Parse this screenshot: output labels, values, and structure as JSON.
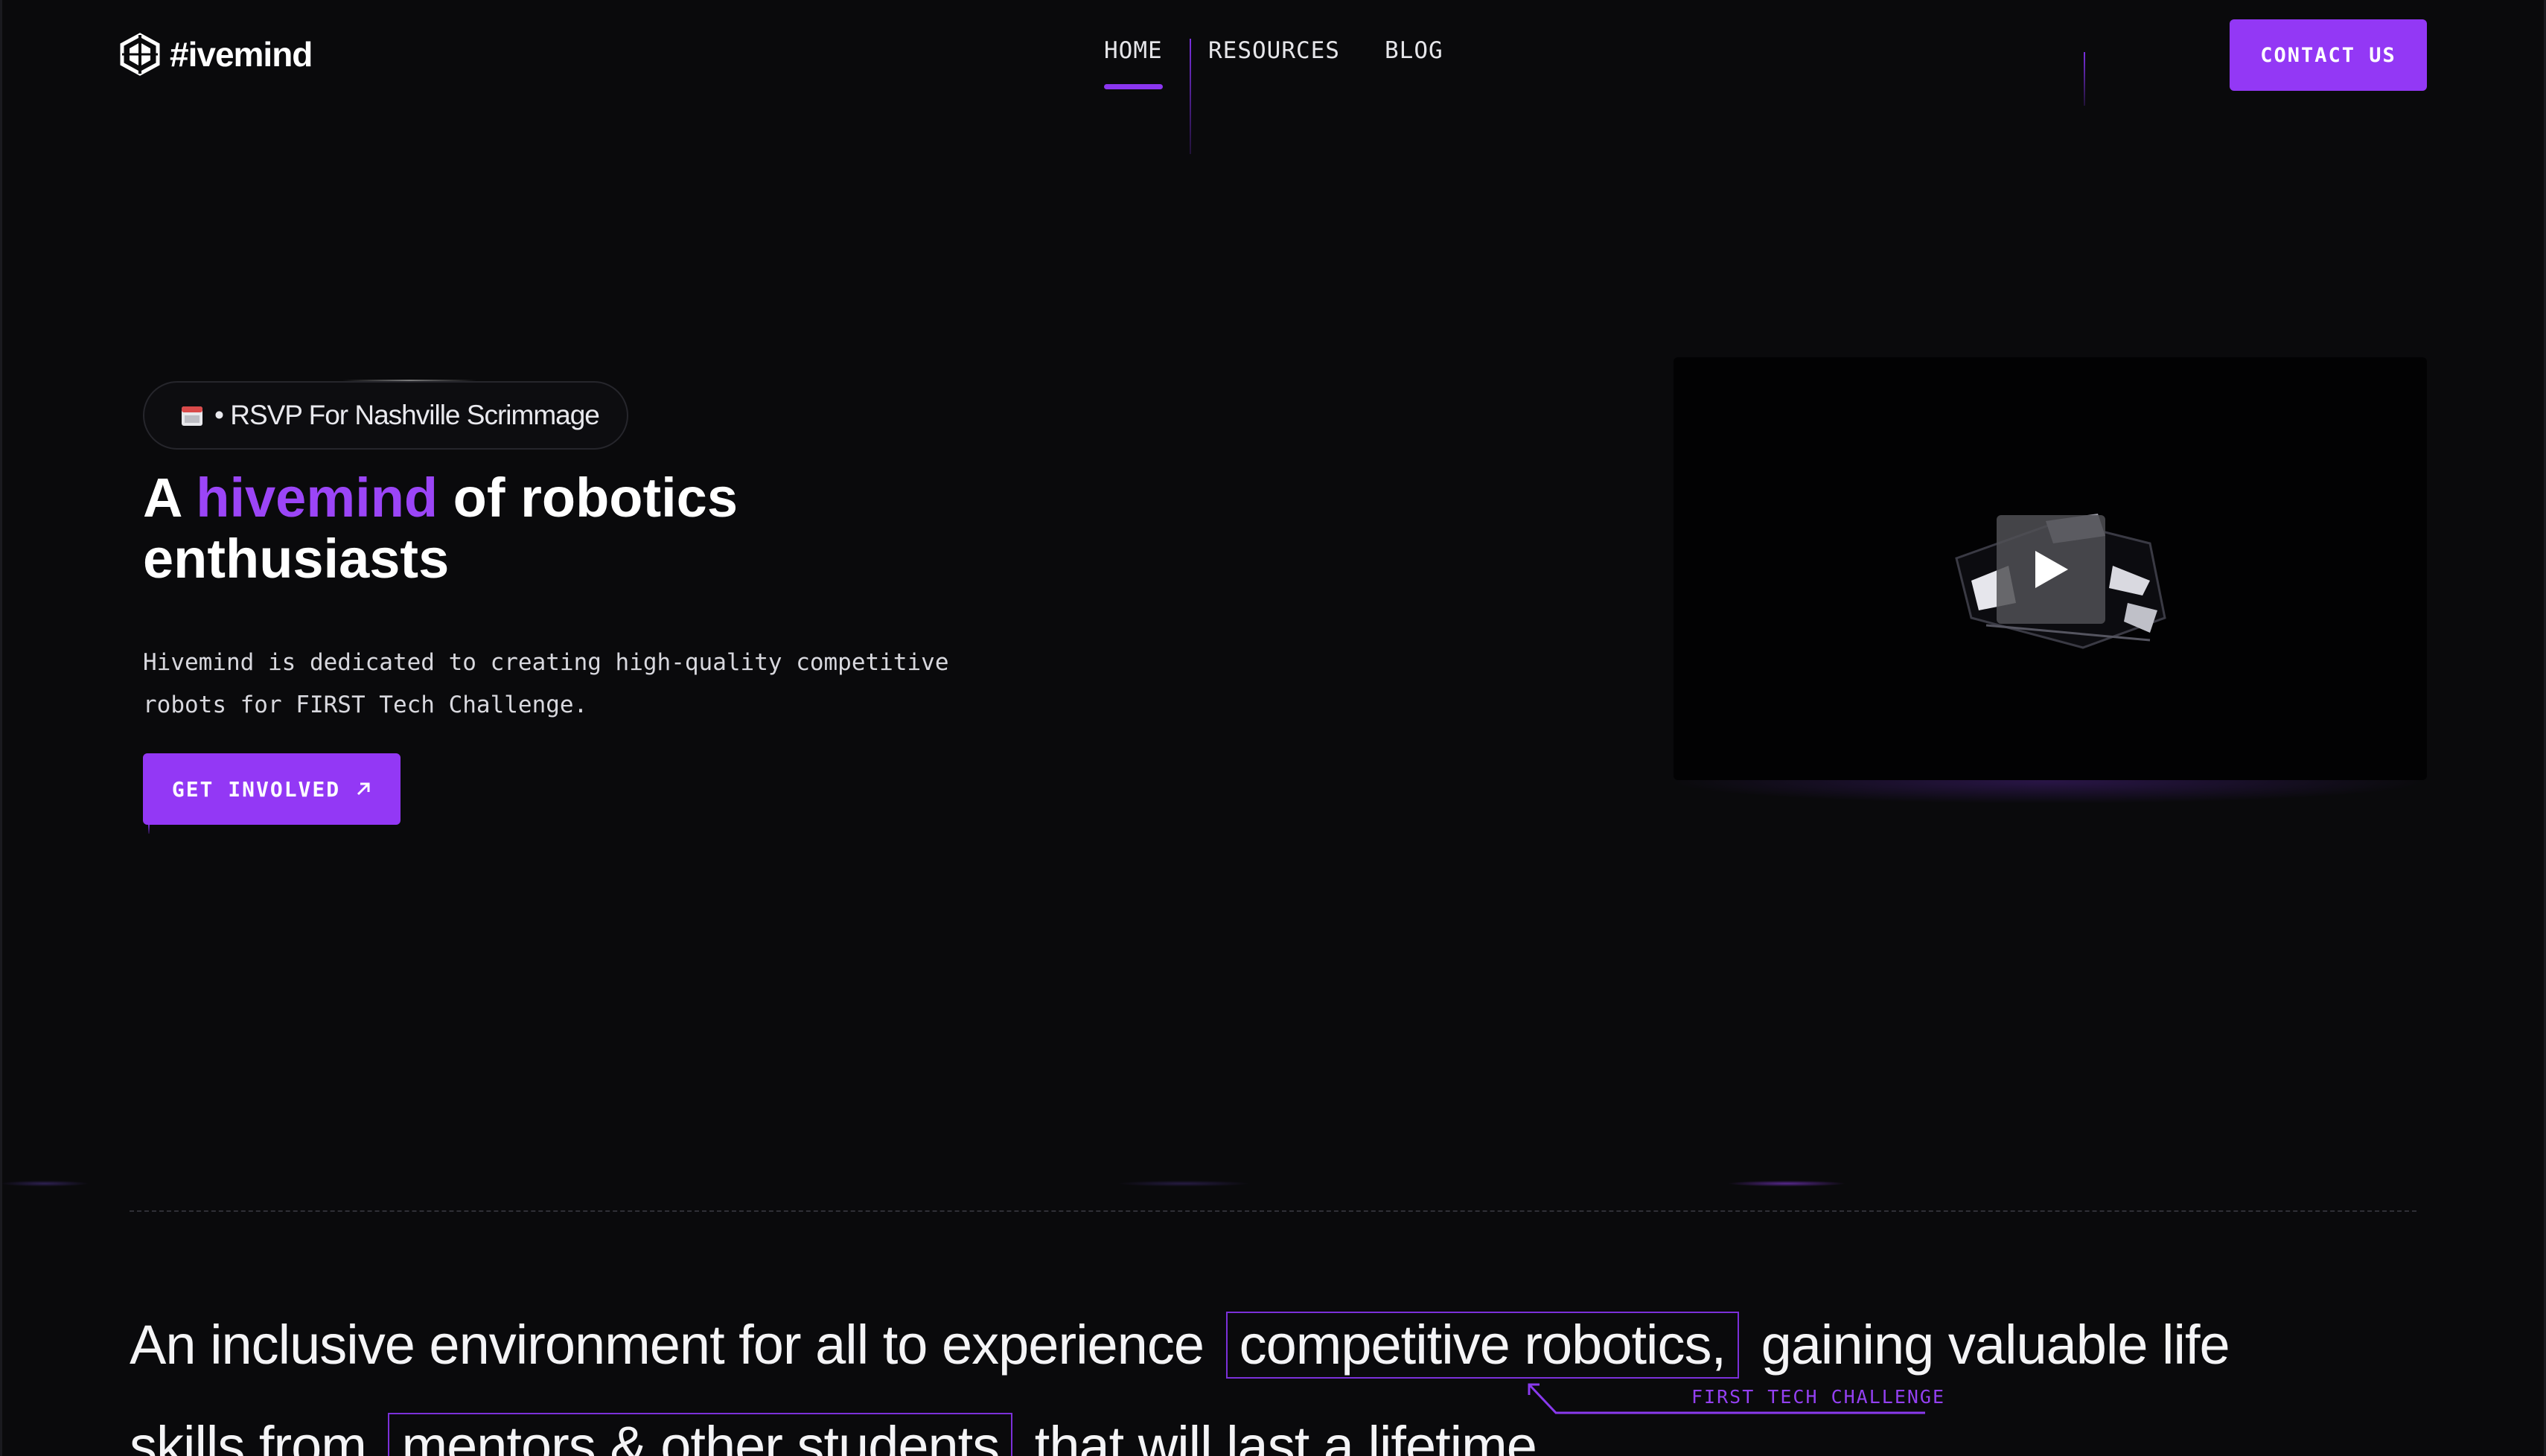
{
  "brand": {
    "name": "#ivemind"
  },
  "nav": {
    "links": [
      {
        "label": "HOME",
        "active": true
      },
      {
        "label": "RESOURCES",
        "active": false
      },
      {
        "label": "BLOG",
        "active": false
      }
    ],
    "contact_label": "CONTACT US"
  },
  "hero": {
    "pill_text": "• RSVP For Nashville Scrimmage",
    "title_pre": "A ",
    "title_accent": "hivemind",
    "title_post_1": " of robotics",
    "title_post_2": "enthusiasts",
    "description_1": "Hivemind is dedicated to creating high-quality competitive",
    "description_2": "robots for FIRST Tech Challenge.",
    "cta_label": "GET INVOLVED",
    "cta_icon": "arrow-up-right-icon"
  },
  "video": {
    "icon": "play-icon"
  },
  "statement": {
    "line1_pre": "An inclusive environment for all to experience",
    "line1_boxed": "competitive robotics,",
    "line1_post": "gaining valuable life",
    "line2_pre": "skills from",
    "line2_boxed": "mentors & other students",
    "line2_post": "that will last a lifetime.",
    "annotation": "FIRST TECH CHALLENGE"
  },
  "colors": {
    "accent": "#9338f5",
    "background": "#0a0a0c",
    "text": "#ffffff"
  }
}
